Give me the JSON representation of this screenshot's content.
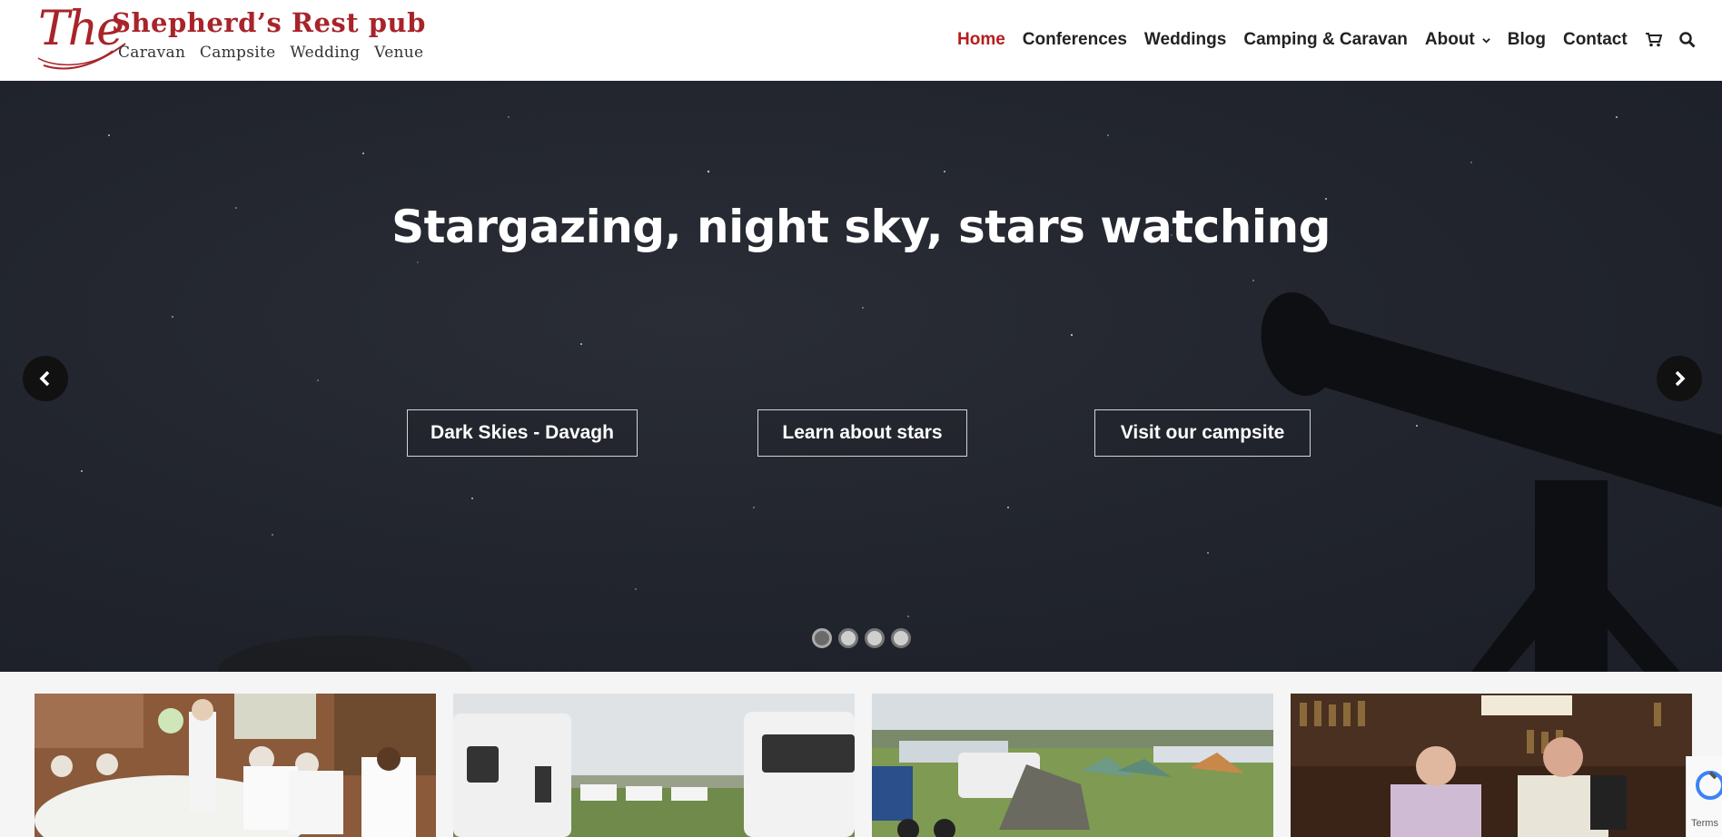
{
  "logo": {
    "the": "The",
    "name": "Shepherd’s Rest pub",
    "tagline": "Caravan Campsite Wedding Venue"
  },
  "nav": {
    "items": [
      {
        "label": "Home",
        "active": true
      },
      {
        "label": "Conferences"
      },
      {
        "label": "Weddings"
      },
      {
        "label": "Camping & Caravan"
      },
      {
        "label": "About"
      },
      {
        "label": "Blog"
      },
      {
        "label": "Contact"
      }
    ],
    "icons": [
      "cart-icon",
      "search-icon"
    ]
  },
  "hero": {
    "title": "Stargazing, night sky, stars watching",
    "buttons": [
      "Dark Skies - Davagh",
      "Learn about stars",
      "Visit our campsite"
    ],
    "slides_total": 4,
    "active_slide": 1
  },
  "thumbnails": [
    "wedding-reception-photo",
    "caravans-photo",
    "campsite-tents-photo",
    "pub-bar-photo"
  ],
  "recaptcha": {
    "label": "Terms"
  },
  "colors": {
    "accent": "#b71c1c",
    "logo_red": "#a8242a",
    "hero_bg": "#22252e"
  }
}
